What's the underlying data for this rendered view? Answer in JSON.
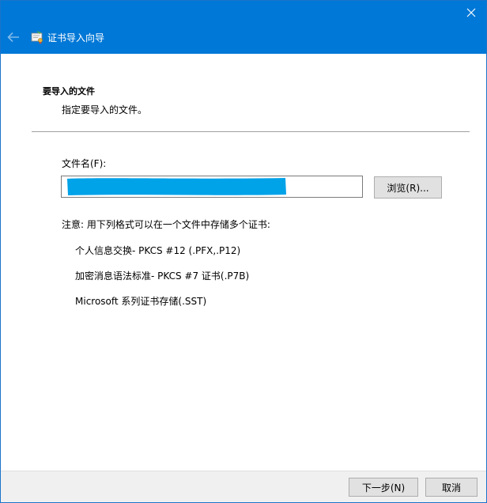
{
  "window": {
    "title": "证书导入向导",
    "close_icon": "close-icon",
    "back_icon": "arrow-left-icon",
    "wizard_icon": "certificate-icon",
    "accent_color": "#0078d7",
    "redaction_color": "#00a2e8"
  },
  "header": {
    "title": "要导入的文件",
    "description": "指定要导入的文件。"
  },
  "file": {
    "label": "文件名(F):",
    "value": "",
    "browse_label": "浏览(R)..."
  },
  "note": "注意: 用下列格式可以在一个文件中存储多个证书:",
  "formats": [
    "个人信息交换- PKCS #12 (.PFX,.P12)",
    "加密消息语法标准- PKCS #7 证书(.P7B)",
    "Microsoft 系列证书存储(.SST)"
  ],
  "footer": {
    "next_label": "下一步(N)",
    "cancel_label": "取消"
  }
}
